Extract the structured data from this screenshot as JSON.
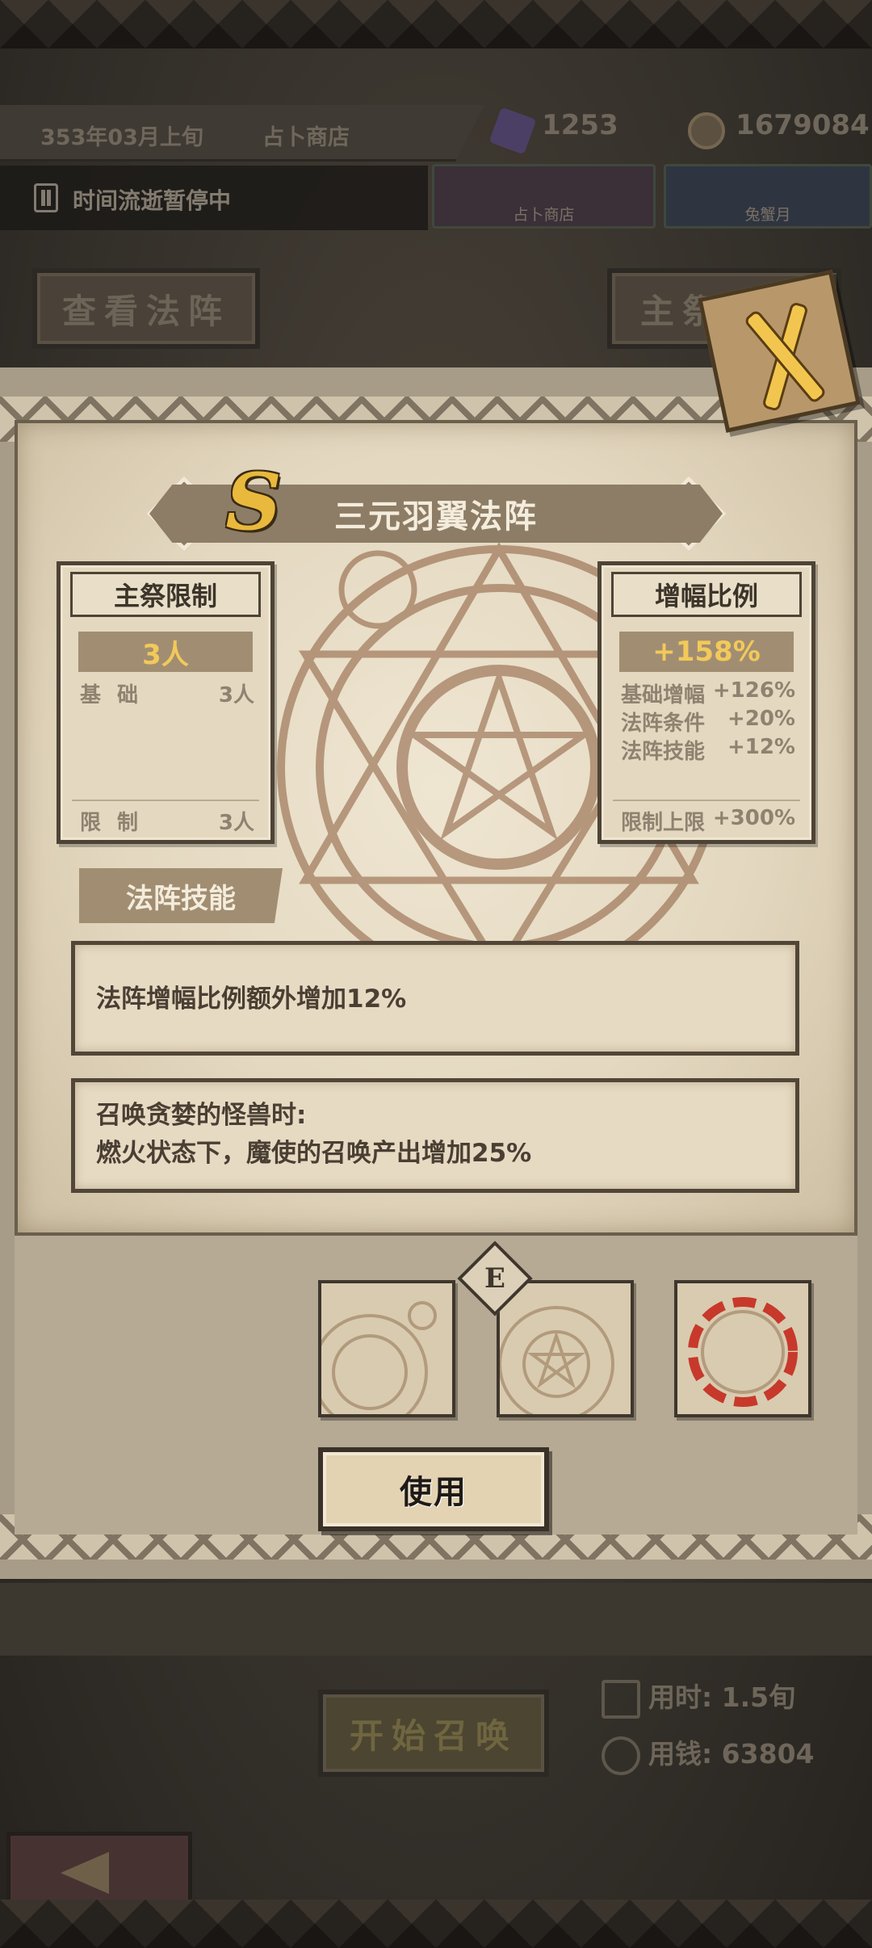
{
  "header": {
    "date": "353年03月上旬",
    "location": "占卜商店",
    "crystals": "1253",
    "coins": "1679084"
  },
  "status": {
    "pause_text": "时间流逝暂停中",
    "thumb1_label": "占卜商店",
    "thumb2_label": "兔蟹月"
  },
  "background_buttons": {
    "view_array": "查看法阵",
    "priest_change": "主祭变更"
  },
  "dialog": {
    "grade": "S",
    "title": "三元羽翼法阵",
    "left_box": {
      "heading": "主祭限制",
      "main_value": "3人",
      "base_label": "基础",
      "base_value": "3人",
      "limit_label": "限制",
      "limit_value": "3人"
    },
    "right_box": {
      "heading": "增幅比例",
      "main_value": "+158%",
      "rows": [
        {
          "label": "基础增幅",
          "value": "+126%"
        },
        {
          "label": "法阵条件",
          "value": "+20%"
        },
        {
          "label": "法阵技能",
          "value": "+12%"
        }
      ],
      "cap_label": "限制上限",
      "cap_value": "+300%"
    },
    "skill_tab": "法阵技能",
    "skill_desc": "法阵增幅比例额外增加12%",
    "condition_line1": "召唤贪婪的怪兽时:",
    "condition_line2": "燃火状态下，魔使的召唤产出增加25%",
    "selected_marker": "E",
    "use_button": "使用"
  },
  "bottom": {
    "start_summon": "开始召唤",
    "time_used": "用时: 1.5旬",
    "money_used": "用钱: 63804"
  },
  "colors": {
    "accent_gold": "#f2c95a",
    "paper": "#e4d8c0",
    "banner": "#8d7d66",
    "highlight_red": "#c7392b"
  }
}
